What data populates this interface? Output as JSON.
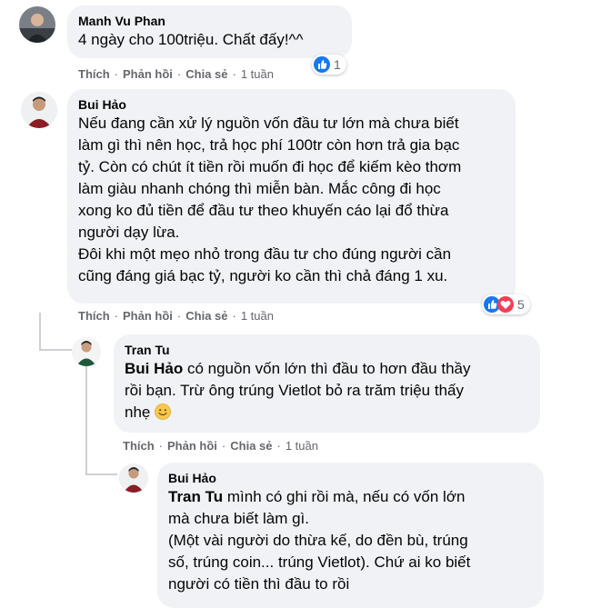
{
  "colors": {
    "bubble": "#f0f2f5",
    "like_blue": "#1877f2",
    "love_red": "#f33e58",
    "secondary_text": "#65676b"
  },
  "comments": [
    {
      "author": "Manh Vu Phan",
      "text": "4 ngày cho 100triệu. Chất đấy!^^",
      "actions": {
        "like": "Thích",
        "reply": "Phản hồi",
        "share": "Chia sẻ",
        "time": "1 tuần"
      },
      "reactions": {
        "icons": [
          "like-icon"
        ],
        "count": "1"
      }
    },
    {
      "author": "Bui Hảo",
      "text": "Nếu đang cần xử lý nguồn vốn đầu tư lớn mà chưa biết\nlàm gì thì nên học, trả học phí 100tr còn hơn trả gia bạc\ntỷ. Còn có chút ít tiền rồi muốn đi học để kiếm kèo thơm\nlàm giàu nhanh chóng thì miễn bàn. Mắc công đi học\nxong ko đủ tiền để đầu tư theo khuyến cáo lại đổ thừa\nngười dạy lừa.\nĐôi khi một mẹo nhỏ trong đầu tư cho đúng người cần\ncũng đáng giá bạc tỷ, người ko cần thì chả đáng 1 xu.",
      "actions": {
        "like": "Thích",
        "reply": "Phản hồi",
        "share": "Chia sẻ",
        "time": "1 tuần"
      },
      "reactions": {
        "icons": [
          "like-icon",
          "love-icon"
        ],
        "count": "5"
      }
    }
  ],
  "replies": [
    {
      "author": "Tran Tu",
      "mention": "Bui Hảo",
      "text": " có nguồn vốn lớn thì đầu to hơn đầu thầy\nrồi bạn. Trừ ông trúng Vietlot bỏ ra trăm triệu thấy\nnhẹ ",
      "emoji": "smile-emoji",
      "actions": {
        "like": "Thích",
        "reply": "Phản hồi",
        "share": "Chia sẻ",
        "time": "1 tuần"
      }
    },
    {
      "author": "Bui Hảo",
      "mention": "Tran Tu",
      "text": " mình có ghi rồi mà, nếu có vốn lớn\nmà chưa biết làm gì.\n(Một vài người do thừa kế, do đền bù, trúng\nsố, trúng coin... trúng Vietlot). Chứ ai ko biết\nngười có tiền thì đầu to rồi"
    }
  ]
}
